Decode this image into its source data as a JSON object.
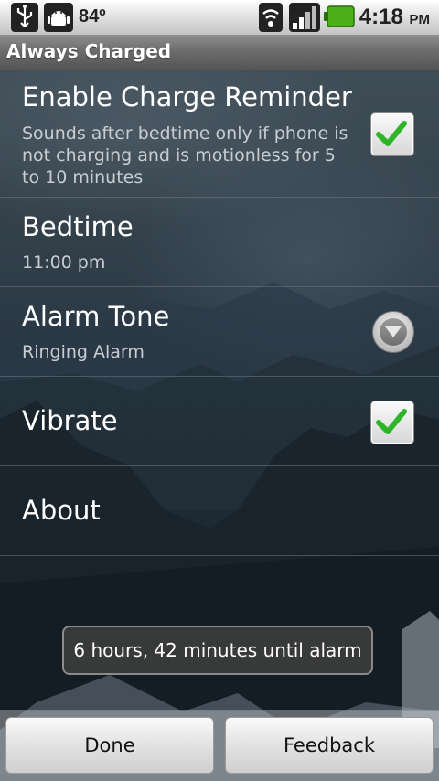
{
  "status_bar": {
    "temperature": "84º",
    "time": "4:18",
    "ampm": "PM",
    "icons": [
      "usb-icon",
      "android-debug-icon",
      "wifi-icon",
      "signal-icon",
      "battery-icon"
    ],
    "battery_color": "#4caf1a"
  },
  "app": {
    "title": "Always Charged"
  },
  "preferences": [
    {
      "title": "Enable Charge Reminder",
      "summary": "Sounds after bedtime only if phone is not charging and is motionless for 5 to 10 minutes",
      "widget": "checkbox",
      "checked": true
    },
    {
      "title": "Bedtime",
      "summary": "11:00 pm"
    },
    {
      "title": "Alarm Tone",
      "summary": "Ringing Alarm",
      "widget": "dropdown"
    },
    {
      "title": "Vibrate",
      "widget": "checkbox",
      "checked": true
    },
    {
      "title": "About"
    }
  ],
  "toast": {
    "text": "6 hours, 42 minutes until alarm"
  },
  "buttons": {
    "done": "Done",
    "feedback": "Feedback"
  },
  "colors": {
    "check_green": "#2fb52a",
    "title_bar": "#6d6d6d"
  }
}
